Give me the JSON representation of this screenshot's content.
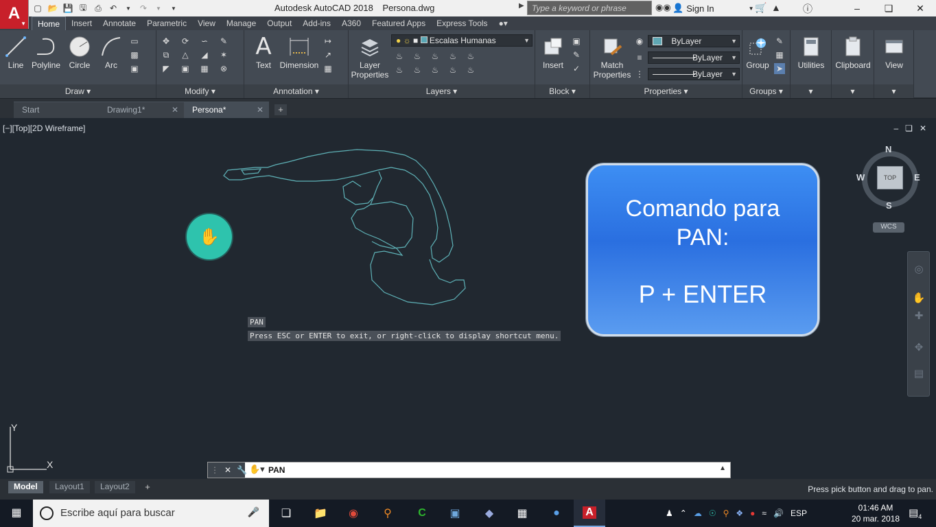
{
  "titlebar": {
    "app_title": "Autodesk AutoCAD 2018",
    "file_title": "Persona.dwg",
    "logo_letter": "A",
    "search_placeholder": "Type a keyword or phrase",
    "signin_label": "Sign In"
  },
  "ribbon_tabs": [
    "Home",
    "Insert",
    "Annotate",
    "Parametric",
    "View",
    "Manage",
    "Output",
    "Add-ins",
    "A360",
    "Featured Apps",
    "Express Tools"
  ],
  "panels": {
    "draw": {
      "title": "Draw",
      "tools": [
        "Line",
        "Polyline",
        "Circle",
        "Arc"
      ]
    },
    "modify": {
      "title": "Modify"
    },
    "annotation": {
      "title": "Annotation",
      "tools": [
        "Text",
        "Dimension"
      ]
    },
    "layers": {
      "title": "Layers",
      "layer_properties_label": "Layer Properties",
      "current_layer": "Escalas Humanas"
    },
    "block": {
      "title": "Block",
      "insert_label": "Insert"
    },
    "properties": {
      "title": "Properties",
      "match_label": "Match Properties",
      "color": "ByLayer",
      "linetype": "ByLayer",
      "lineweight": "ByLayer"
    },
    "groups": {
      "title": "Groups",
      "group_label": "Group"
    },
    "utilities": {
      "title": "Utilities"
    },
    "clipboard": {
      "title": "Clipboard"
    },
    "view": {
      "title": "View"
    }
  },
  "file_tabs": [
    {
      "label": "Start",
      "closable": false
    },
    {
      "label": "Drawing1*",
      "closable": true
    },
    {
      "label": "Persona*",
      "closable": true
    }
  ],
  "viewport": {
    "label": "[−][Top][2D Wireframe]",
    "overlay_line1": "Comando para",
    "overlay_line2": "PAN:",
    "overlay_line3": "P + ENTER",
    "viewcube_face": "TOP",
    "compass": {
      "n": "N",
      "s": "S",
      "e": "E",
      "w": "W"
    },
    "wcs_label": "WCS",
    "ucs_x": "X",
    "ucs_y": "Y"
  },
  "command": {
    "history": [
      "PAN",
      "Press ESC or ENTER to exit, or right-click to display shortcut menu."
    ],
    "current": "PAN"
  },
  "layout_tabs": [
    "Model",
    "Layout1",
    "Layout2"
  ],
  "status_message": "Press pick button and drag to pan.",
  "taskbar": {
    "search_placeholder": "Escribe aquí para buscar",
    "language": "ESP",
    "time": "01:46 AM",
    "date": "20 mar. 2018",
    "notification_count": "4"
  },
  "colors": {
    "drawing_line": "#5fb3b8",
    "pan_cursor": "#2ec3ad",
    "overlay_blue": "#2a6fe0",
    "autocad_red": "#c8202a"
  }
}
